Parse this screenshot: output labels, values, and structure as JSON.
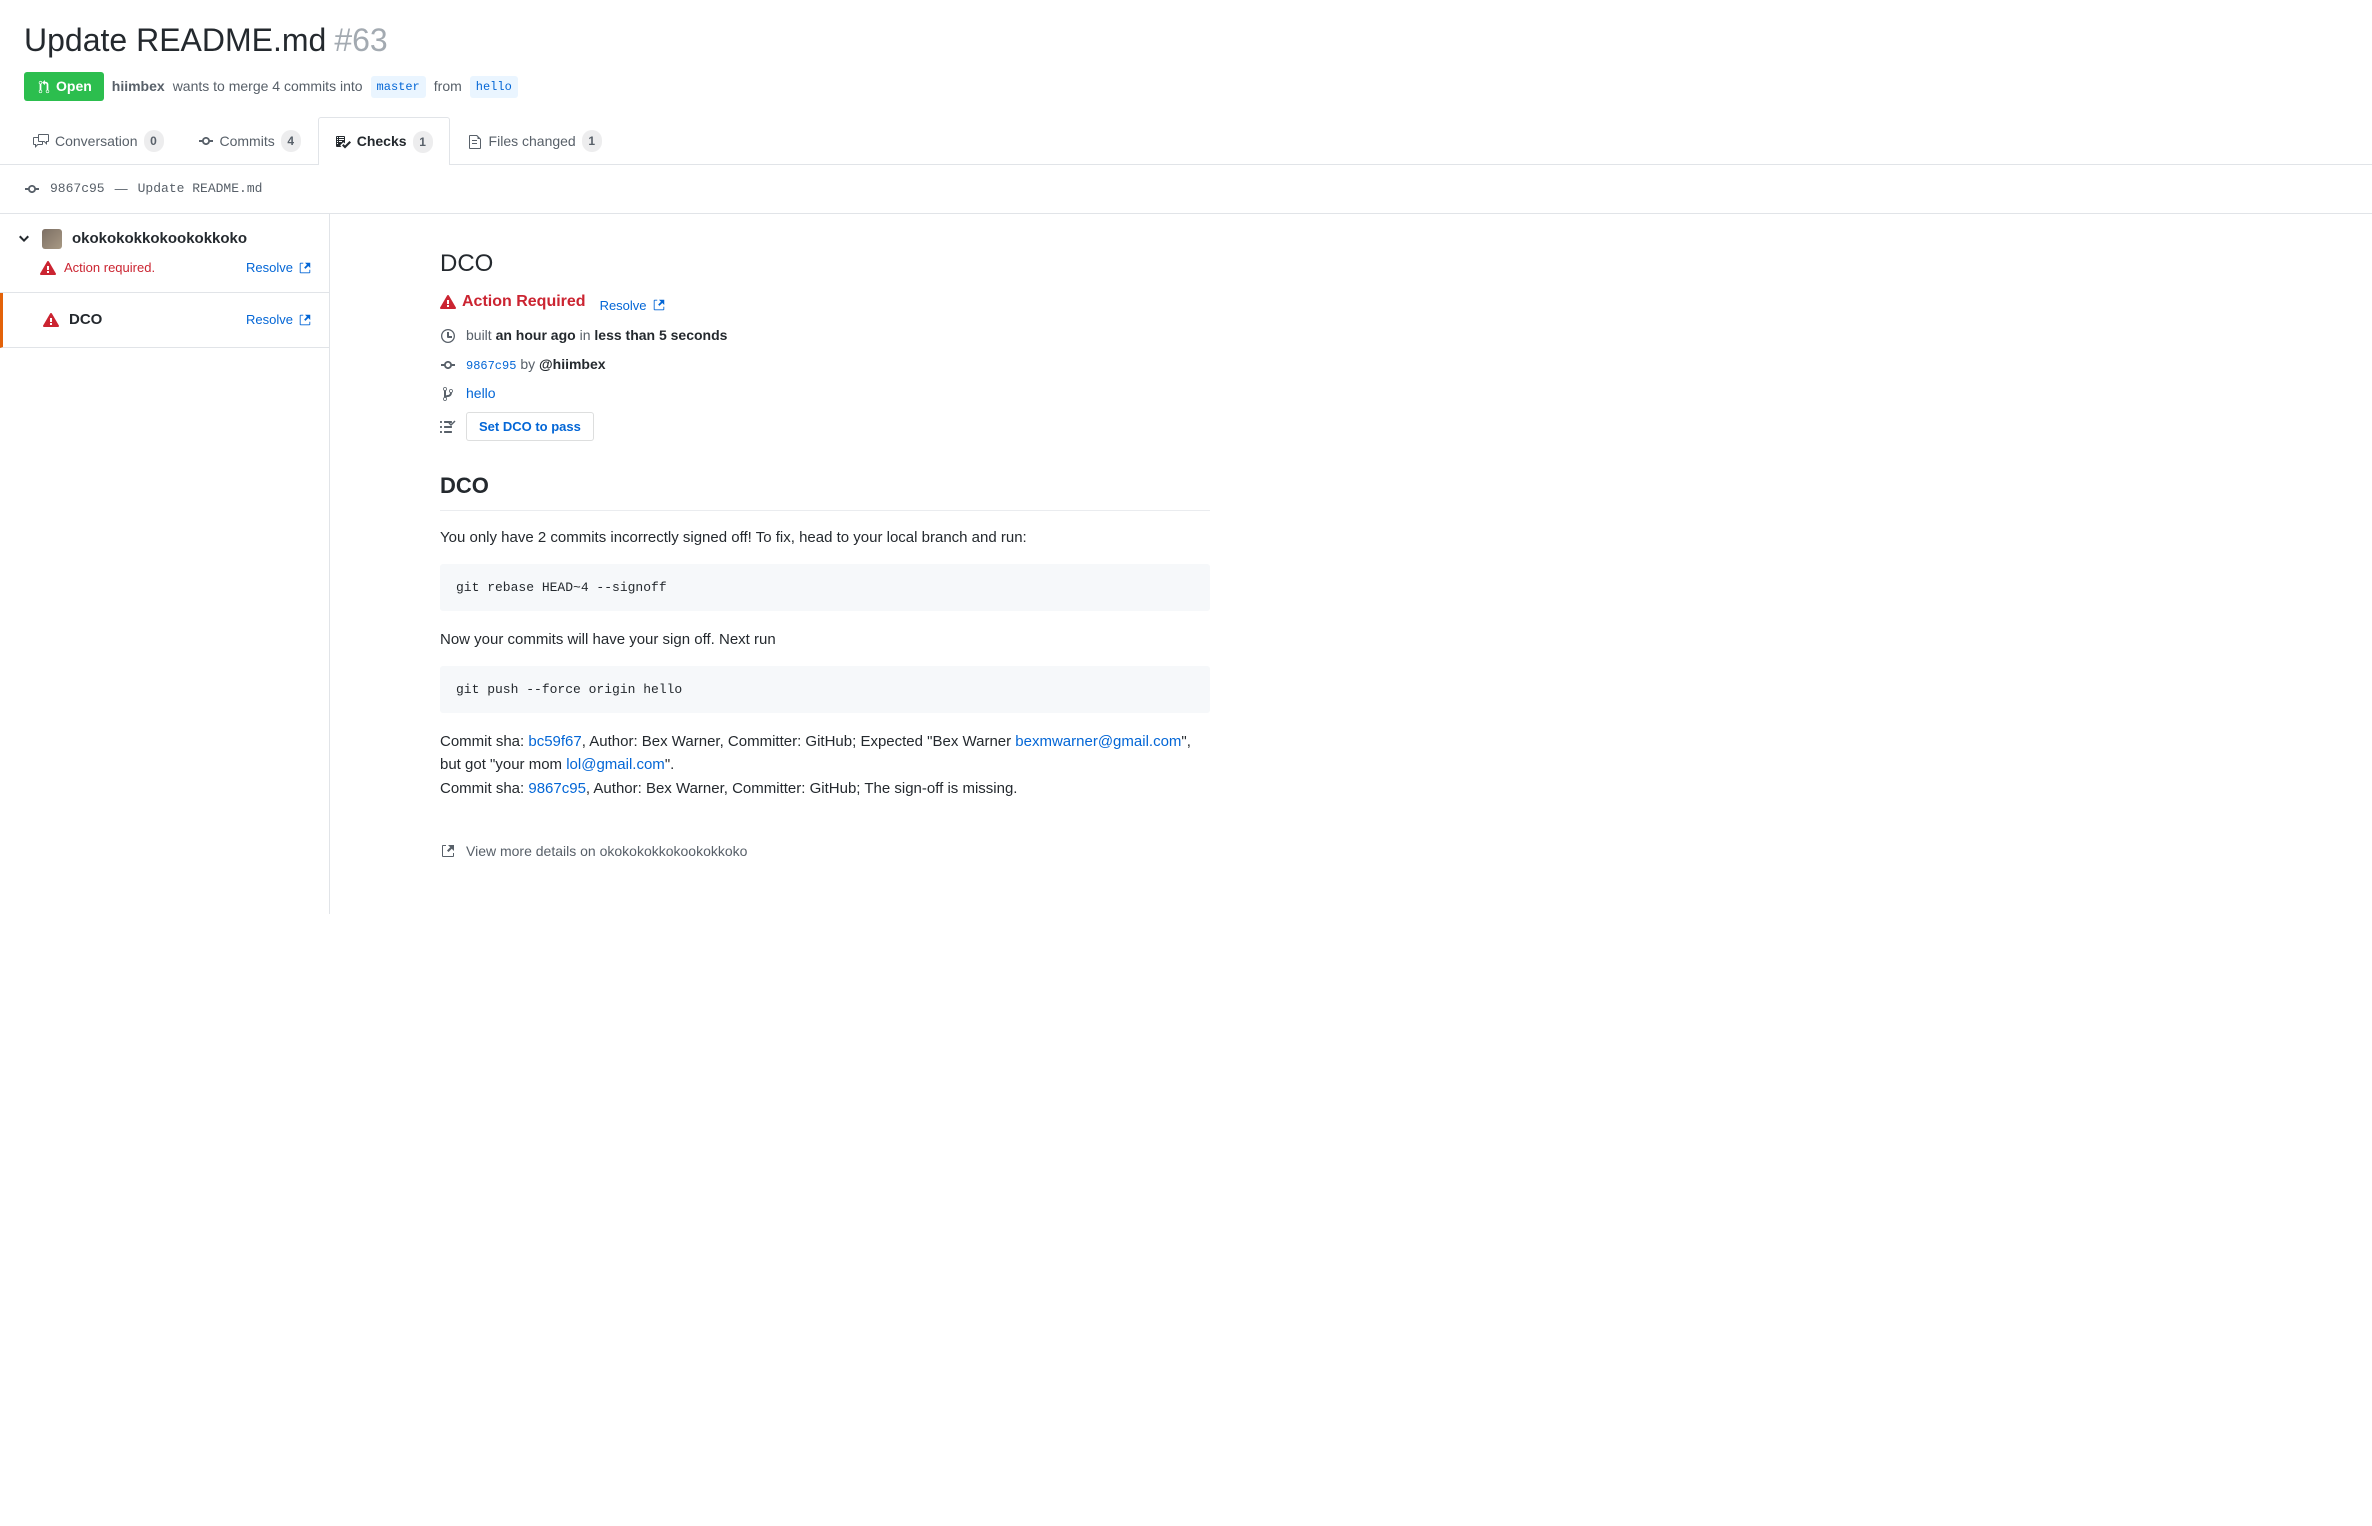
{
  "header": {
    "title": "Update README.md",
    "number": "#63",
    "state": "Open",
    "user": "hiimbex",
    "merge_text_1": "wants to merge 4 commits into",
    "base_branch": "master",
    "merge_text_2": "from",
    "head_branch": "hello"
  },
  "tabs": {
    "conversation": {
      "label": "Conversation",
      "count": "0"
    },
    "commits": {
      "label": "Commits",
      "count": "4"
    },
    "checks": {
      "label": "Checks",
      "count": "1"
    },
    "files": {
      "label": "Files changed",
      "count": "1"
    }
  },
  "commit_bar": {
    "sha": "9867c95",
    "sep": "—",
    "message": "Update README.md"
  },
  "sidebar": {
    "app_name": "okokokokkokookokkoko",
    "status_text": "Action required.",
    "resolve_label": "Resolve",
    "check_name": "DCO"
  },
  "check": {
    "title": "DCO",
    "status_label": "Action Required",
    "resolve_label": "Resolve",
    "built_prefix": "built",
    "built_time": "an hour ago",
    "built_in": "in",
    "duration": "less than 5 seconds",
    "commit_sha": "9867c95",
    "by_label": "by",
    "author": "@hiimbex",
    "branch": "hello",
    "set_pass_label": "Set DCO to pass",
    "section_title": "DCO",
    "intro_text": "You only have 2 commits incorrectly signed off! To fix, head to your local branch and run:",
    "code1": "git rebase HEAD~4 --signoff",
    "mid_text": "Now your commits will have your sign off. Next run",
    "code2": "git push --force origin hello",
    "commit1_prefix": "Commit sha: ",
    "commit1_sha": "bc59f67",
    "commit1_mid": ", Author: Bex Warner, Committer: GitHub; Expected \"Bex Warner ",
    "commit1_email": "bexmwarner@gmail.com",
    "commit1_after": "\", but got \"your mom ",
    "commit1_email2": "lol@gmail.com",
    "commit1_end": "\".",
    "commit2_prefix": "Commit sha: ",
    "commit2_sha": "9867c95",
    "commit2_rest": ", Author: Bex Warner, Committer: GitHub; The sign-off is missing.",
    "view_more": "View more details on okokokokkokookokkoko"
  }
}
